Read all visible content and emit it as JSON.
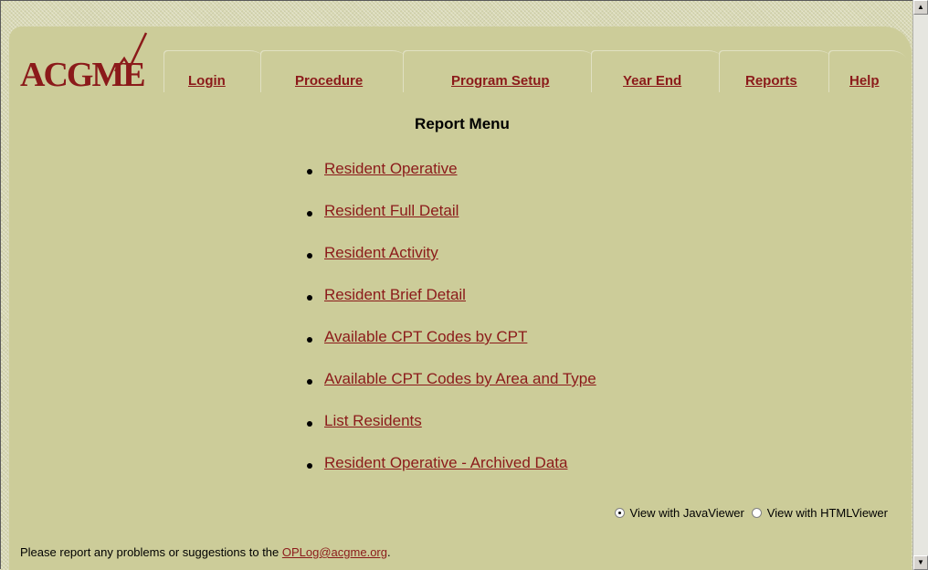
{
  "logo": {
    "text": "ACGME"
  },
  "tabs": [
    {
      "label": "Login"
    },
    {
      "label": "Procedure"
    },
    {
      "label": "Program Setup"
    },
    {
      "label": "Year End"
    },
    {
      "label": "Reports"
    },
    {
      "label": "Help"
    }
  ],
  "menu": {
    "title": "Report Menu",
    "items": [
      {
        "label": "Resident Operative"
      },
      {
        "label": "Resident Full Detail"
      },
      {
        "label": "Resident Activity"
      },
      {
        "label": "Resident Brief Detail"
      },
      {
        "label": "Available CPT Codes by CPT"
      },
      {
        "label": "Available CPT Codes by Area and Type"
      },
      {
        "label": "List Residents"
      },
      {
        "label": "Resident Operative - Archived Data"
      }
    ]
  },
  "viewer": {
    "options": [
      {
        "label": "View with JavaViewer",
        "selected": true
      },
      {
        "label": "View with HTMLViewer",
        "selected": false
      }
    ]
  },
  "footer": {
    "text": "Please report any problems or suggestions to the ",
    "link": "OPLog@acgme.org",
    "suffix": "."
  },
  "colors": {
    "link": "#8b1a1a",
    "panel": "#cccc99",
    "background": "#d8d8b4"
  }
}
